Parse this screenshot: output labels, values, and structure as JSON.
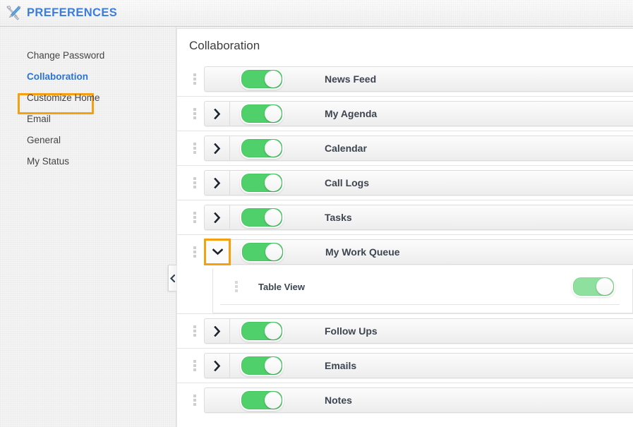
{
  "header": {
    "icon": "tools-icon",
    "title": "PREFERENCES",
    "title_color": "#3b7ddd"
  },
  "sidebar": {
    "items": [
      {
        "label": "Change Password",
        "active": false
      },
      {
        "label": "Collaboration",
        "active": true,
        "highlighted": true
      },
      {
        "label": "Customize Home",
        "active": false
      },
      {
        "label": "Email",
        "active": false
      },
      {
        "label": "General",
        "active": false
      },
      {
        "label": "My Status",
        "active": false
      }
    ],
    "collapse_handle_icon": "chevron-left-icon"
  },
  "main": {
    "title": "Collaboration",
    "modules": [
      {
        "label": "News Feed",
        "expandable": false,
        "expanded": false,
        "enabled": true,
        "drag_handle_icon": "drag-dots-icon"
      },
      {
        "label": "My Agenda",
        "expandable": true,
        "expanded": false,
        "enabled": true,
        "expander_icon": "chevron-right-icon",
        "drag_handle_icon": "drag-dots-icon"
      },
      {
        "label": "Calendar",
        "expandable": true,
        "expanded": false,
        "enabled": true,
        "expander_icon": "chevron-right-icon",
        "drag_handle_icon": "drag-dots-icon"
      },
      {
        "label": "Call Logs",
        "expandable": true,
        "expanded": false,
        "enabled": true,
        "expander_icon": "chevron-right-icon",
        "drag_handle_icon": "drag-dots-icon"
      },
      {
        "label": "Tasks",
        "expandable": true,
        "expanded": false,
        "enabled": true,
        "expander_icon": "chevron-right-icon",
        "drag_handle_icon": "drag-dots-icon"
      },
      {
        "label": "My Work Queue",
        "expandable": true,
        "expanded": true,
        "highlighted": true,
        "enabled": true,
        "expander_icon": "chevron-down-icon",
        "drag_handle_icon": "drag-dots-icon",
        "children": [
          {
            "label": "Table View",
            "enabled": true,
            "toggle_style": "light",
            "drag_handle_icon": "drag-dots-icon"
          }
        ]
      },
      {
        "label": "Follow Ups",
        "expandable": true,
        "expanded": false,
        "enabled": true,
        "expander_icon": "chevron-right-icon",
        "drag_handle_icon": "drag-dots-icon"
      },
      {
        "label": "Emails",
        "expandable": true,
        "expanded": false,
        "enabled": true,
        "expander_icon": "chevron-right-icon",
        "drag_handle_icon": "drag-dots-icon"
      },
      {
        "label": "Notes",
        "expandable": false,
        "expanded": false,
        "enabled": true,
        "drag_handle_icon": "drag-dots-icon"
      }
    ]
  },
  "colors": {
    "accent_blue": "#2e72d2",
    "highlight_orange": "#f5a011",
    "toggle_on_green": "#4fd06a",
    "toggle_on_green_light": "#8ee09e",
    "label_text": "#3d4550"
  }
}
